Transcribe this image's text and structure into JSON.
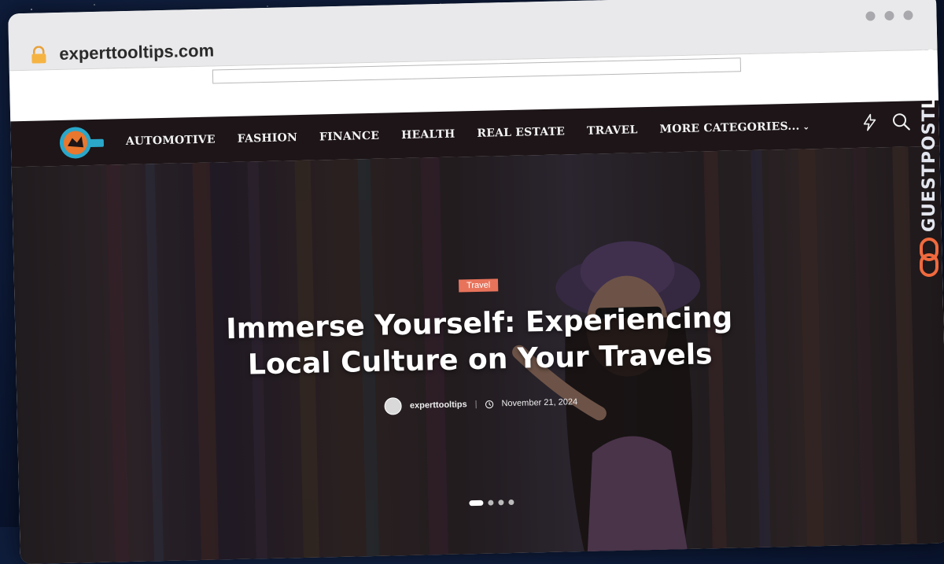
{
  "browser": {
    "url": "experttooltips.com"
  },
  "nav": {
    "items": [
      {
        "label": "AUTOMOTIVE"
      },
      {
        "label": "FASHION"
      },
      {
        "label": "FINANCE"
      },
      {
        "label": "HEALTH"
      },
      {
        "label": "REAL ESTATE"
      },
      {
        "label": "TRAVEL"
      },
      {
        "label": "MORE CATEGORIES..."
      }
    ],
    "icons": [
      "bolt-icon",
      "search-icon"
    ]
  },
  "hero": {
    "category": "Travel",
    "title": "Immerse Yourself: Experiencing Local Culture on Your Travels",
    "author": "experttooltips",
    "date": "November 21, 2024",
    "slides": 4,
    "active_slide": 1
  },
  "watermark": {
    "part1": "GUESTPOST",
    "part2": "LINKS"
  },
  "colors": {
    "nav_bg": "#1d1517",
    "category_badge": "#e8735b",
    "watermark_icon": "#f06a3e"
  }
}
